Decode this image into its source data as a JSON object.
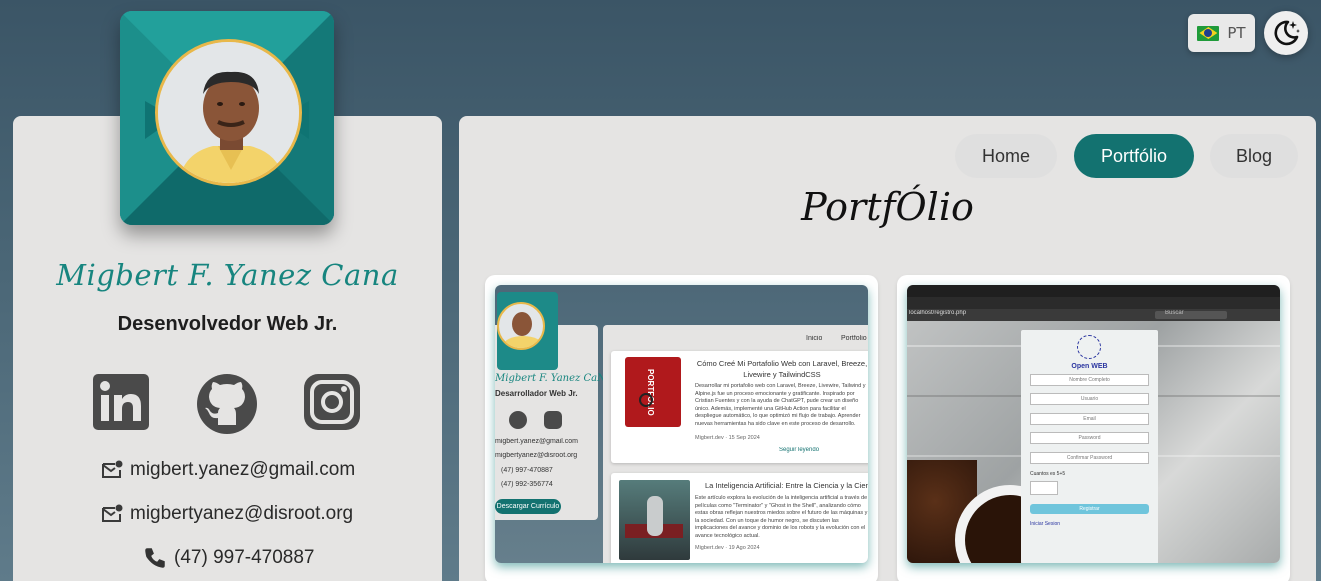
{
  "header": {
    "language": {
      "code": "PT",
      "flag_icon": "brazil-flag-icon"
    },
    "theme_toggle_icon": "moon-stars-icon"
  },
  "profile": {
    "name": "Migbert F. Yanez Cana",
    "role": "Desenvolvedor Web Jr.",
    "social": [
      "linkedin-icon",
      "github-icon",
      "instagram-icon"
    ],
    "emails": [
      "migbert.yanez@gmail.com",
      "migbertyanez@disroot.org"
    ],
    "phone": "(47) 997-470887"
  },
  "nav": {
    "items": [
      {
        "label": "Home",
        "active": false
      },
      {
        "label": "Portfólio",
        "active": true
      },
      {
        "label": "Blog",
        "active": false
      }
    ]
  },
  "page": {
    "title": "PortfÓlio"
  },
  "projects": [
    {
      "thumb": {
        "nav_inicio": "Inicio",
        "nav_portfolio": "Portfolio",
        "name": "Migbert F. Yanez CaÑa",
        "role": "Desarrollador Web Jr.",
        "email1": "migbert.yanez@gmail.com",
        "email2": "migbertyanez@disroot.org",
        "phone1": "(47) 997-470887",
        "phone2": "(47) 992-356774",
        "download": "Descargar Currículo",
        "post1_title": "Cómo Creé Mi Portafolio Web con Laravel, Breeze, Livewire y TailwindCSS",
        "post1_badge": "PORTFOLIO",
        "post1_excerpt": "Desarrollar mi portafolio web con Laravel, Breeze, Livewire, Tailwind y Alpine.js fue un proceso emocionante y gratificante. Inspirado por Cristian Fuentes y con la ayuda de ChatGPT, pude crear un diseño único. Además, implementé una GitHub Action para facilitar el despliegue automático, lo que optimizó mi flujo de trabajo. Aprender nuevas herramientas ha sido clave en este proceso de desarrollo.",
        "post1_meta": "Migbert.dev · 15 Sep 2024",
        "post1_link": "Seguir leyendo",
        "post2_title": "La Inteligencia Artificial: Entre la Ciencia y la Ciencia Ficción",
        "post2_excerpt": "Este artículo explora la evolución de la inteligencia artificial a través de películas como \"Terminator\" y \"Ghost in the Shell\", analizando cómo estas obras reflejan nuestros miedos sobre el futuro de las máquinas y la sociedad. Con un toque de humor negro, se discuten las implicaciones del avance y dominio de los robots y la evolución con el avance tecnológico actual.",
        "post2_meta": "Migbert.dev · 19 Ago 2024"
      }
    },
    {
      "thumb": {
        "url": "localhost/registro.php",
        "search": "Buscar",
        "app_name": "Open WEB",
        "fields": [
          "Nombre Completo",
          "Usuario",
          "Email",
          "Password",
          "Confirmar Password"
        ],
        "captcha_label": "Cuantos es 5+5",
        "submit": "Registrar",
        "login_link": "Iniciar Sesion"
      }
    }
  ]
}
